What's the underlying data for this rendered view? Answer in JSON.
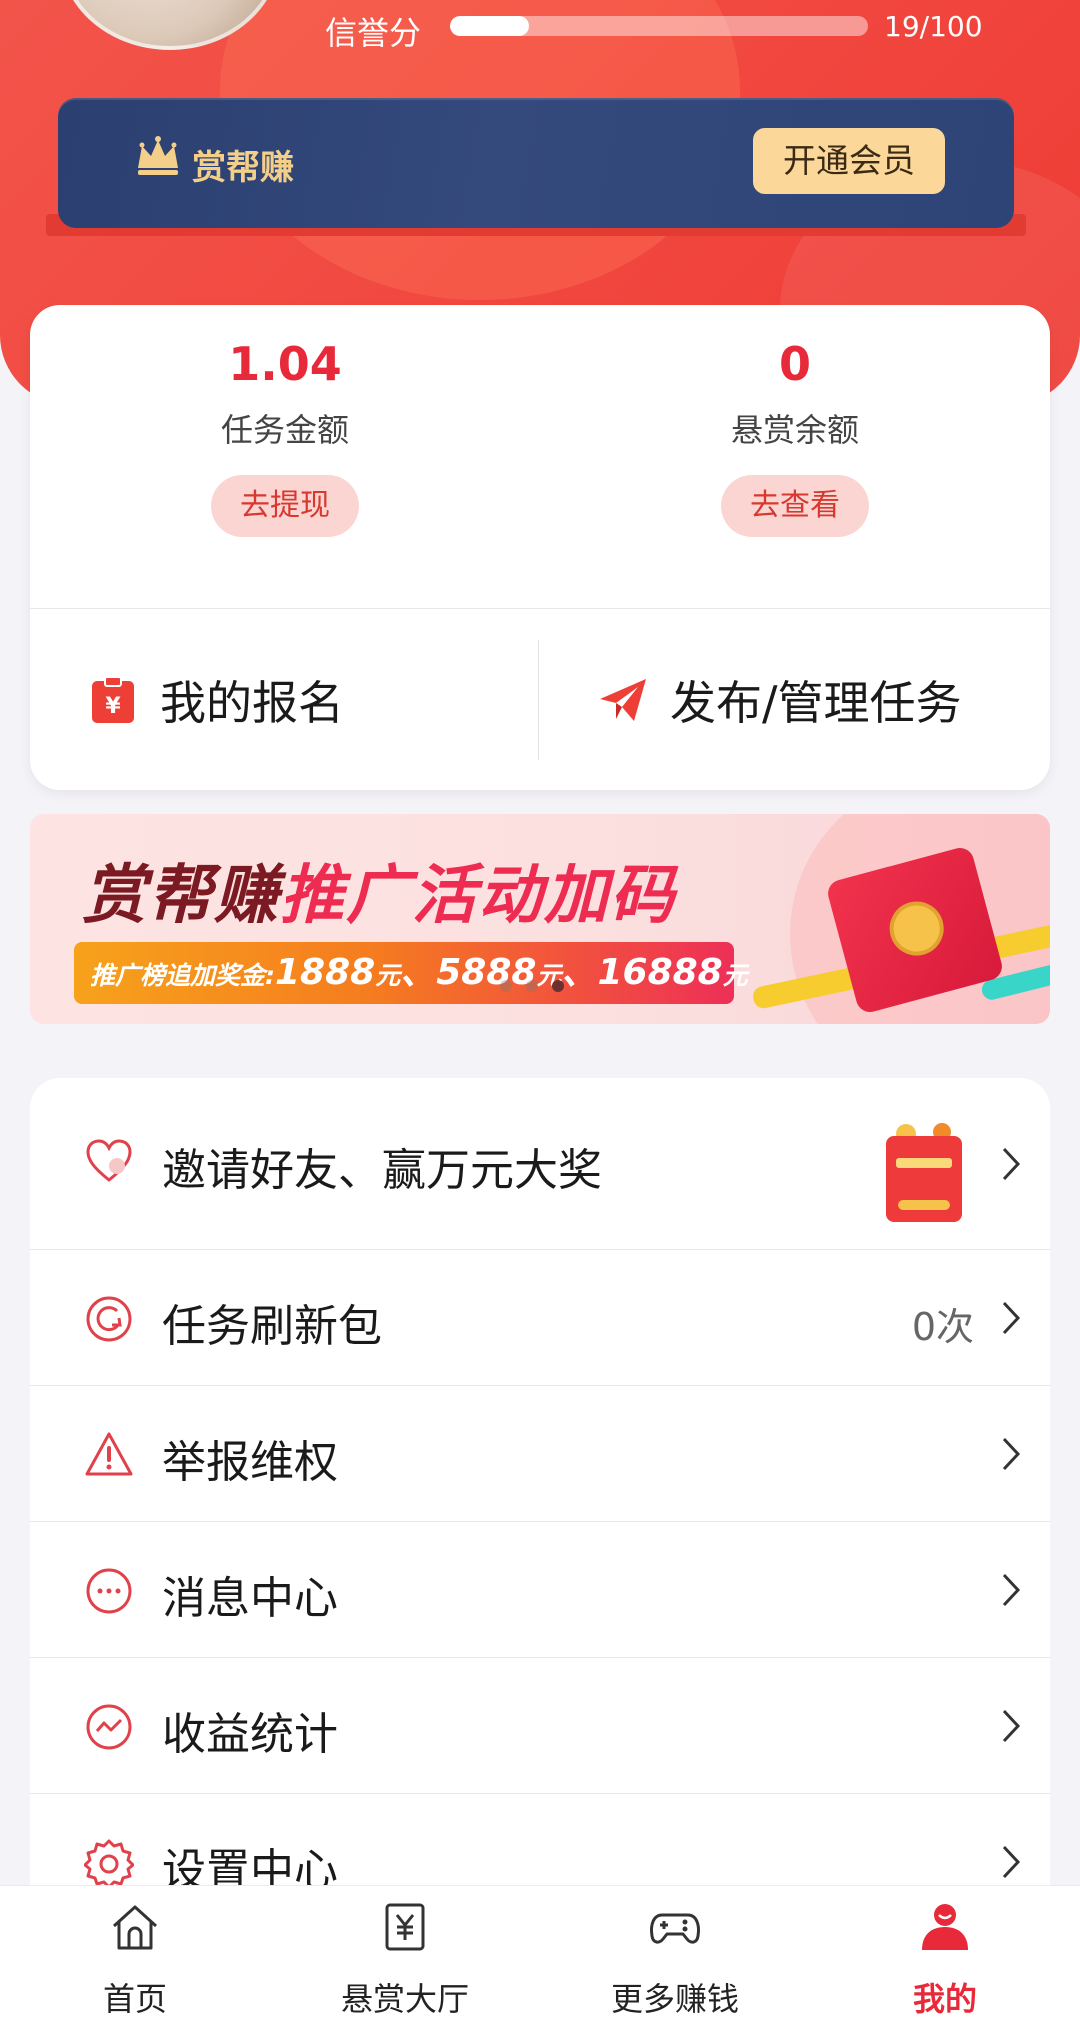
{
  "profile": {
    "credit_label": "信誉分",
    "credit_value": "19/100",
    "credit_progress": 0.19
  },
  "vip": {
    "name": "赏帮赚",
    "button_label": "开通会员"
  },
  "balance": {
    "task_amount": "1.04",
    "task_amount_label": "任务金额",
    "task_button": "去提现",
    "reward_balance": "0",
    "reward_balance_label": "悬赏余额",
    "reward_button": "去查看"
  },
  "actions": {
    "my_signups": "我的报名",
    "publish_manage": "发布/管理任务"
  },
  "banner": {
    "title_part1": "赏帮赚",
    "title_part2": "推广活动加码",
    "subtitle_prefix": "推广榜追加奖金:",
    "amount1": "1888",
    "amount2": "5888",
    "amount3": "16888",
    "unit": "元",
    "sep": "、",
    "active_dot": 2
  },
  "menu": {
    "invite": {
      "label": "邀请好友、赢万元大奖",
      "icon": "heart-icon"
    },
    "refresh": {
      "label": "任务刷新包",
      "value": "0次",
      "icon": "refresh-icon"
    },
    "report": {
      "label": "举报维权",
      "icon": "warning-icon"
    },
    "messages": {
      "label": "消息中心",
      "icon": "chat-icon"
    },
    "earnings": {
      "label": "收益统计",
      "icon": "chart-icon"
    },
    "settings": {
      "label": "设置中心",
      "icon": "gear-icon"
    }
  },
  "tabs": [
    {
      "label": "首页",
      "icon": "home-icon"
    },
    {
      "label": "悬赏大厅",
      "icon": "yuan-icon"
    },
    {
      "label": "更多赚钱",
      "icon": "gamepad-icon"
    },
    {
      "label": "我的",
      "icon": "user-icon",
      "active": true
    }
  ],
  "colors": {
    "primary": "#e8293a",
    "header": "#f1473f",
    "vip_bg": "#2e4476",
    "vip_gold": "#f4cf8a"
  }
}
